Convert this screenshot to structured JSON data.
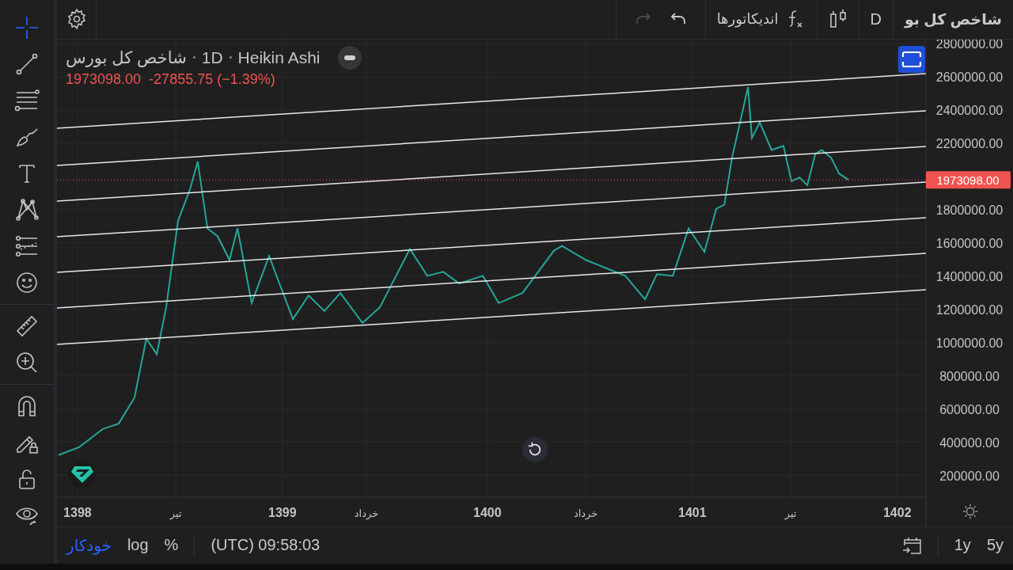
{
  "top_bar": {
    "symbol": "شاخص کل بو",
    "interval": "D",
    "indicators_label": "اندیکاتورها",
    "redo_disabled": true
  },
  "tool_groups": [
    [
      {
        "selected": true
      },
      {
        "selected": false
      },
      {
        "selected": false
      },
      {
        "selected": false
      },
      {
        "selected": false
      },
      {
        "selected": false
      },
      {
        "selected": false
      },
      {
        "selected": false
      }
    ],
    [
      {
        "selected": false
      },
      {
        "selected": false
      }
    ],
    [
      {
        "selected": false
      },
      {
        "selected": false
      },
      {
        "selected": false
      },
      {
        "selected": false
      }
    ]
  ],
  "legend": {
    "interval": "1D",
    "chart_type": "Heikin Ashi",
    "last": "1973098.00",
    "change": "-27855.75 (−1.39%)"
  },
  "price_label": "1973098.00",
  "chart_data": {
    "type": "line",
    "grid": true,
    "xlim": [
      1397.9,
      1402.14
    ],
    "ylim": [
      69000,
      2825000
    ],
    "xticks": [
      {
        "value": 1398,
        "label": "1398"
      },
      {
        "value": 1398.48,
        "label": "تیر"
      },
      {
        "value": 1399,
        "label": "1399"
      },
      {
        "value": 1399.41,
        "label": "خرداد"
      },
      {
        "value": 1400,
        "label": "1400"
      },
      {
        "value": 1400.48,
        "label": "خرداد"
      },
      {
        "value": 1401,
        "label": "1401"
      },
      {
        "value": 1401.48,
        "label": "تیر"
      },
      {
        "value": 1402,
        "label": "1402"
      }
    ],
    "yticks": [
      {
        "value": 2800000,
        "label": "2800000.00"
      },
      {
        "value": 2600000,
        "label": "2600000.00"
      },
      {
        "value": 2400000,
        "label": "2400000.00"
      },
      {
        "value": 2200000,
        "label": "2200000.00"
      },
      {
        "value": 1800000,
        "label": "1800000.00"
      },
      {
        "value": 1600000,
        "label": "1600000.00"
      },
      {
        "value": 1400000,
        "label": "1400000.00"
      },
      {
        "value": 1200000,
        "label": "1200000.00"
      },
      {
        "value": 1000000,
        "label": "1000000.00"
      },
      {
        "value": 800000,
        "label": "800000.00"
      },
      {
        "value": 600000,
        "label": "600000.00"
      },
      {
        "value": 400000,
        "label": "400000.00"
      },
      {
        "value": 200000,
        "label": "200000.00"
      }
    ],
    "x": [
      1397.908,
      1398.008,
      1398.124,
      1398.201,
      1398.278,
      1398.336,
      1398.387,
      1398.433,
      1398.491,
      1398.549,
      1398.587,
      1398.634,
      1398.684,
      1398.742,
      1398.781,
      1398.85,
      1398.935,
      1399.051,
      1399.128,
      1399.205,
      1399.283,
      1399.391,
      1399.476,
      1399.622,
      1399.707,
      1399.785,
      1399.862,
      1399.978,
      1400.055,
      1400.171,
      1400.325,
      1400.364,
      1400.48,
      1400.596,
      1400.673,
      1400.769,
      1400.827,
      1400.905,
      1400.982,
      1401.059,
      1401.117,
      1401.156,
      1401.194,
      1401.272,
      1401.291,
      1401.329,
      1401.387,
      1401.445,
      1401.484,
      1401.523,
      1401.561,
      1401.6,
      1401.631,
      1401.677,
      1401.716,
      1401.762
    ],
    "series": [
      {
        "name": "شاخص کل بورس",
        "color": "#26a69a",
        "values": [
          323000,
          370000,
          480000,
          512000,
          668000,
          1024000,
          930000,
          1214000,
          1734000,
          1924000,
          2090000,
          1688000,
          1640000,
          1498000,
          1688000,
          1238000,
          1522000,
          1142000,
          1284000,
          1190000,
          1298000,
          1118000,
          1214000,
          1564000,
          1402000,
          1426000,
          1356000,
          1402000,
          1238000,
          1298000,
          1554000,
          1582000,
          1498000,
          1440000,
          1402000,
          1260000,
          1412000,
          1402000,
          1688000,
          1546000,
          1806000,
          1830000,
          2114000,
          2540000,
          2232000,
          2326000,
          2160000,
          2184000,
          1972000,
          1994000,
          1948000,
          2136000,
          2160000,
          2114000,
          2018000,
          1980000
        ]
      }
    ]
  },
  "scale_modes": [
    {
      "label": "خودکار",
      "selected": true
    },
    {
      "label": "log",
      "selected": false
    },
    {
      "label": "%",
      "selected": false
    }
  ],
  "clock": "(UTC) 09:58:03",
  "ranges": [
    {
      "label": "1y"
    },
    {
      "label": "5y"
    }
  ]
}
